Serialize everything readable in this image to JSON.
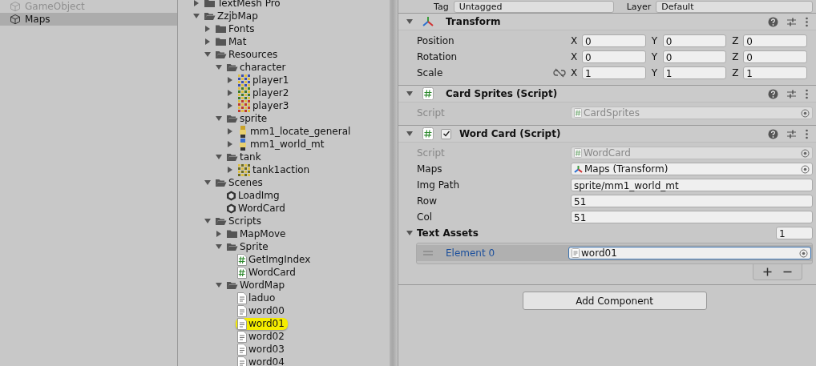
{
  "hierarchy": {
    "items": [
      {
        "label": "GameObject",
        "dimmed": true,
        "selected": false
      },
      {
        "label": "Maps",
        "dimmed": false,
        "selected": true
      }
    ]
  },
  "project": {
    "tree": [
      {
        "label": "TextMesh Pro",
        "kind": "folder",
        "expanded": false,
        "selected": false
      },
      {
        "label": "ZzjbMap",
        "kind": "folder",
        "expanded": true,
        "selected": false,
        "children": [
          {
            "label": "Fonts",
            "kind": "folder",
            "expanded": false,
            "selected": false
          },
          {
            "label": "Mat",
            "kind": "folder",
            "expanded": false,
            "selected": false
          },
          {
            "label": "Resources",
            "kind": "folder",
            "expanded": true,
            "selected": false,
            "children": [
              {
                "label": "character",
                "kind": "folder",
                "expanded": true,
                "selected": false,
                "children": [
                  {
                    "label": "player1",
                    "kind": "texture",
                    "expanded": false,
                    "selected": false
                  },
                  {
                    "label": "player2",
                    "kind": "texture",
                    "expanded": false,
                    "selected": false
                  },
                  {
                    "label": "player3",
                    "kind": "texture",
                    "expanded": false,
                    "selected": false
                  }
                ]
              },
              {
                "label": "sprite",
                "kind": "folder",
                "expanded": true,
                "selected": false,
                "children": [
                  {
                    "label": "mm1_locate_general",
                    "kind": "sprite",
                    "expanded": false,
                    "selected": false
                  },
                  {
                    "label": "mm1_world_mt",
                    "kind": "sprite",
                    "expanded": false,
                    "selected": false
                  }
                ]
              },
              {
                "label": "tank",
                "kind": "folder",
                "expanded": true,
                "selected": false,
                "children": [
                  {
                    "label": "tank1action",
                    "kind": "texture",
                    "expanded": false,
                    "selected": false
                  }
                ]
              }
            ]
          },
          {
            "label": "Scenes",
            "kind": "folder",
            "expanded": true,
            "selected": false,
            "children": [
              {
                "label": "LoadImg",
                "kind": "scene",
                "selected": false
              },
              {
                "label": "WordCard",
                "kind": "scene",
                "selected": false
              }
            ]
          },
          {
            "label": "Scripts",
            "kind": "folder",
            "expanded": true,
            "selected": false,
            "children": [
              {
                "label": "MapMove",
                "kind": "folder",
                "expanded": false,
                "selected": false
              },
              {
                "label": "Sprite",
                "kind": "folder",
                "expanded": true,
                "selected": false,
                "children": [
                  {
                    "label": "GetImgIndex",
                    "kind": "script",
                    "selected": false
                  },
                  {
                    "label": "WordCard",
                    "kind": "script",
                    "selected": false
                  }
                ]
              },
              {
                "label": "WordMap",
                "kind": "folder",
                "expanded": true,
                "selected": false,
                "children": [
                  {
                    "label": "laduo",
                    "kind": "text",
                    "selected": false
                  },
                  {
                    "label": "word00",
                    "kind": "text",
                    "selected": false
                  },
                  {
                    "label": "word01",
                    "kind": "text",
                    "selected": true
                  },
                  {
                    "label": "word02",
                    "kind": "text",
                    "selected": false
                  },
                  {
                    "label": "word03",
                    "kind": "text",
                    "selected": false
                  },
                  {
                    "label": "word04",
                    "kind": "text",
                    "selected": false
                  }
                ]
              }
            ]
          }
        ]
      }
    ]
  },
  "inspector": {
    "top_row": {
      "tag_label": "Tag",
      "tag_value": "Untagged",
      "layer_label": "Layer",
      "layer_value": "Default"
    },
    "components": [
      {
        "kind": "transform",
        "title": "Transform",
        "expanded": true,
        "rows": [
          {
            "kind": "vector",
            "label": "Position",
            "axes": [
              {
                "axis": "X",
                "value": "0"
              },
              {
                "axis": "Y",
                "value": "0"
              },
              {
                "axis": "Z",
                "value": "0"
              }
            ]
          },
          {
            "kind": "vector",
            "label": "Rotation",
            "axes": [
              {
                "axis": "X",
                "value": "0"
              },
              {
                "axis": "Y",
                "value": "0"
              },
              {
                "axis": "Z",
                "value": "0"
              }
            ]
          },
          {
            "kind": "vector",
            "label": "Scale",
            "proportions_linked": false,
            "axes": [
              {
                "axis": "X",
                "value": "1"
              },
              {
                "axis": "Y",
                "value": "1"
              },
              {
                "axis": "Z",
                "value": "1"
              }
            ]
          }
        ]
      },
      {
        "kind": "script",
        "title": "Card Sprites (Script)",
        "expanded": true,
        "rows": [
          {
            "kind": "script",
            "label": "Script",
            "value": "CardSprites",
            "disabled": true
          }
        ]
      },
      {
        "kind": "script",
        "title": "Word Card (Script)",
        "expanded": true,
        "enabled": true,
        "rows": [
          {
            "kind": "script",
            "label": "Script",
            "value": "WordCard",
            "disabled": true
          },
          {
            "kind": "object",
            "label": "Maps",
            "value": "Maps (Transform)"
          },
          {
            "kind": "text",
            "label": "Img Path",
            "value": "sprite/mm1_world_mt"
          },
          {
            "kind": "text",
            "label": "Row",
            "value": "51"
          },
          {
            "kind": "text",
            "label": "Col",
            "value": "51"
          },
          {
            "kind": "list",
            "label": "Text Assets",
            "expanded": true,
            "count": "1",
            "elements": [
              {
                "label": "Element 0",
                "value": "word01",
                "focused": true
              }
            ]
          }
        ]
      }
    ],
    "add_button": "Add Component"
  }
}
